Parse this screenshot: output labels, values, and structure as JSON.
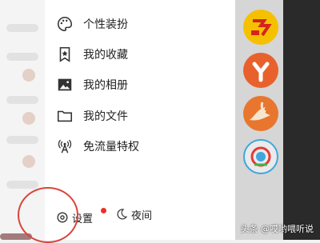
{
  "drawer": {
    "menu_items": [
      {
        "label": "个性装扮",
        "icon": "palette-icon"
      },
      {
        "label": "我的收藏",
        "icon": "bookmark-star-icon"
      },
      {
        "label": "我的相册",
        "icon": "image-icon"
      },
      {
        "label": "我的文件",
        "icon": "folder-icon"
      },
      {
        "label": "免流量特权",
        "icon": "signal-tower-icon"
      }
    ],
    "settings_label": "设置",
    "night_label": "夜间"
  },
  "watermark": "头条 @哎哟喂听说",
  "colors": {
    "accent_red": "#e5322d",
    "app_yellow": "#f5c000",
    "app_orange": "#e8612c",
    "app_blue": "#3fa6dd"
  }
}
